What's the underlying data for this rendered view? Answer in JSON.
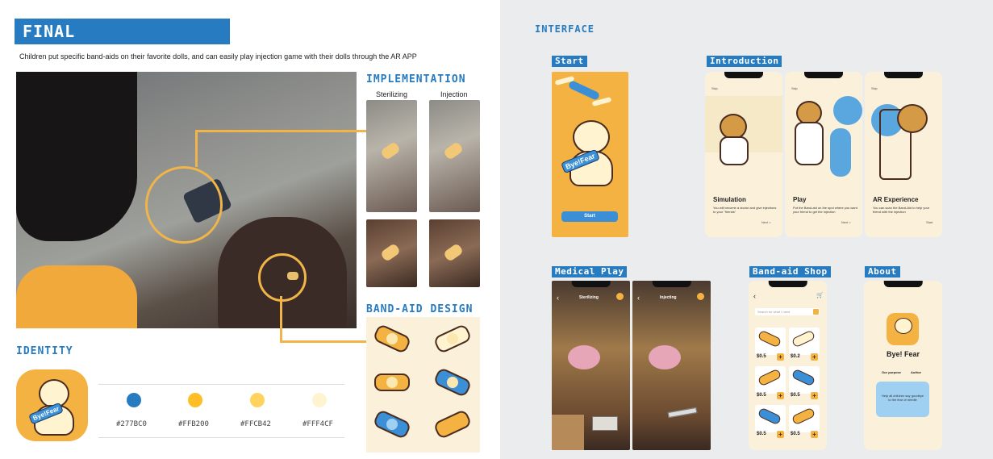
{
  "left": {
    "banner": "FINAL IMPLEMENTATION",
    "subtitle": "Children put specific band-aids on their favorite dolls, and can easily play injection game with their dolls through the AR APP",
    "implementation": {
      "title": "IMPLEMENTATION",
      "col1": "Sterilizing",
      "col2": "Injection",
      "thumb_header1": "Sterilizing",
      "thumb_header2": "Injection"
    },
    "bandaid_title": "BAND-AID DESIGN",
    "identity": {
      "title": "IDENTITY",
      "logo_text": "Bye!Fear",
      "colors": [
        {
          "hex": "#277BC0",
          "value": "#277bc0"
        },
        {
          "hex": "#FFB200",
          "value": "#ffb200"
        },
        {
          "hex": "#FFCB42",
          "value": "#ffcb42"
        },
        {
          "hex": "#FFF4CF",
          "value": "#fff4cf"
        }
      ]
    }
  },
  "right": {
    "title": "INTERFACE",
    "start": {
      "tag": "Start",
      "button": "Start",
      "logo_text": "Bye!Fear"
    },
    "introduction": {
      "tag": "Introduction",
      "skip": "Skip",
      "screens": [
        {
          "title": "Simulation",
          "text": "You will become a doctor and give injections to your \"friends\"",
          "nav": "Next >"
        },
        {
          "title": "Play",
          "text": "Put the Band-aid on the spot where you want your friend to get the injection",
          "nav": "Next >"
        },
        {
          "title": "AR Experience",
          "text": "You can scan the Band-Aid to help your friend with the injection",
          "nav": "Start"
        }
      ]
    },
    "medical_play": {
      "tag": "Medical Play",
      "screen1": "Sterilizing",
      "screen2": "Injecting"
    },
    "shop": {
      "tag": "Band-aid Shop",
      "search_placeholder": "Search for what I need",
      "prices": [
        "$0.5",
        "$0.2",
        "$0.5",
        "$0.5",
        "$0.5",
        "$0.5"
      ]
    },
    "about": {
      "tag": "About",
      "app_name": "Bye! Fear",
      "tab1": "Our purpose",
      "tab2": "Author",
      "card_text": "Help all children say goodbye to the fear of needle"
    }
  }
}
